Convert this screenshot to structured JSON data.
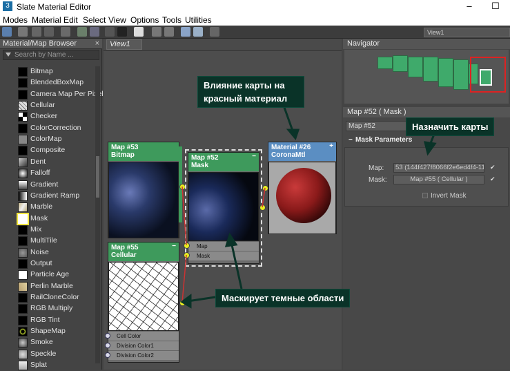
{
  "window": {
    "title": "Slate Material Editor",
    "app_icon": "3",
    "minimize": "–",
    "maximize": "☐"
  },
  "menu": [
    "Modes",
    "Material",
    "Edit",
    "Select",
    "View",
    "Options",
    "Tools",
    "Utilities"
  ],
  "toolbar": {
    "view_dropdown": "View1"
  },
  "browser": {
    "title": "Material/Map Browser",
    "close": "×",
    "search_placeholder": "Search by Name ...",
    "items": [
      {
        "label": "Bitmap",
        "icon": "black-swatch"
      },
      {
        "label": "BlendedBoxMap",
        "icon": "black-swatch"
      },
      {
        "label": "Camera Map Per Pixel",
        "icon": "black-swatch"
      },
      {
        "label": "Cellular",
        "icon": "cellular-swatch"
      },
      {
        "label": "Checker",
        "icon": "checker-swatch"
      },
      {
        "label": "ColorCorrection",
        "icon": "black-swatch"
      },
      {
        "label": "ColorMap",
        "icon": "grey-swatch"
      },
      {
        "label": "Composite",
        "icon": "black-swatch"
      },
      {
        "label": "Dent",
        "icon": "dent-swatch"
      },
      {
        "label": "Falloff",
        "icon": "falloff-swatch"
      },
      {
        "label": "Gradient",
        "icon": "gradient-swatch"
      },
      {
        "label": "Gradient Ramp",
        "icon": "gradient-ramp-swatch"
      },
      {
        "label": "Marble",
        "icon": "marble-swatch"
      },
      {
        "label": "Mask",
        "icon": "white-swatch"
      },
      {
        "label": "Mix",
        "icon": "black-swatch"
      },
      {
        "label": "MultiTile",
        "icon": "black-swatch"
      },
      {
        "label": "Noise",
        "icon": "noise-swatch"
      },
      {
        "label": "Output",
        "icon": "black-swatch"
      },
      {
        "label": "Particle Age",
        "icon": "white-swatch"
      },
      {
        "label": "Perlin Marble",
        "icon": "perlin-swatch"
      },
      {
        "label": "RailCloneColor",
        "icon": "black-swatch"
      },
      {
        "label": "RGB Multiply",
        "icon": "black-swatch"
      },
      {
        "label": "RGB Tint",
        "icon": "black-swatch"
      },
      {
        "label": "ShapeMap",
        "icon": "shapemap-swatch"
      },
      {
        "label": "Smoke",
        "icon": "smoke-swatch"
      },
      {
        "label": "Speckle",
        "icon": "speckle-swatch"
      },
      {
        "label": "Splat",
        "icon": "splat-swatch"
      }
    ],
    "selected_item": "Mask"
  },
  "view": {
    "tab": "View1",
    "nodes": {
      "bitmap": {
        "id": "Map #53",
        "type": "Bitmap"
      },
      "mask": {
        "id": "Map #52",
        "type": "Mask",
        "min": "−",
        "slots": [
          "Map",
          "Mask"
        ]
      },
      "material": {
        "id": "Material #26",
        "type": "CoronaMtl",
        "plus": "+"
      },
      "cellular": {
        "id": "Map #55",
        "type": "Cellular",
        "min": "−",
        "slots": [
          "Cell Color",
          "Division Color1",
          "Division Color2"
        ]
      }
    }
  },
  "navigator": {
    "title": "Navigator"
  },
  "properties": {
    "title": "Map #52  ( Mask )",
    "name_field": "Map #52",
    "rollout": "Mask Parameters",
    "rollout_toggle": "−",
    "map_label": "Map:",
    "map_value": "53 (144f427f8066f2e6ed4f4-115",
    "mask_label": "Mask:",
    "mask_value": "Map #55  ( Cellular )",
    "checkmark": "✔",
    "invert_label": "Invert Mask"
  },
  "annotations": {
    "red_material": "Влияние карты на красный материал",
    "assign_maps": "Назначить карты",
    "masks_dark": "Маскирует темные области"
  },
  "colors": {
    "annotation_bg": "#0a3328",
    "node_green": "#3e9a5c",
    "node_blue": "#5b8ec2",
    "highlight_yellow": "#f2e640"
  }
}
